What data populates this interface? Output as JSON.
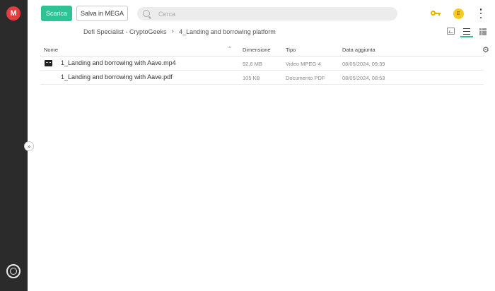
{
  "sidebar": {
    "logo_letter": "M",
    "expand_glyph": "»"
  },
  "toolbar": {
    "download_label": "Scarica",
    "save_label": "Salva in MEGA",
    "search_placeholder": "Cerca",
    "avatar_initial": "E",
    "accent_color": "#2fc294",
    "key_color": "#e3b400",
    "avatar_color": "#f6cb1b"
  },
  "breadcrumb": {
    "items": [
      "Defi Specialist - CryptoGeeks",
      "4_Landing and borrowing platform"
    ],
    "separator": "›"
  },
  "table": {
    "headers": {
      "name": "Nome",
      "size": "Dimensione",
      "type": "Tipo",
      "date": "Data aggiunta"
    },
    "sort_glyph": "⌃",
    "rows": [
      {
        "icon": "video-file-icon",
        "name": "1_Landing and borrowing with Aave.mp4",
        "size": "92,6 MB",
        "type": "Video MPEG-4",
        "date": "08/05/2024, 09:39"
      },
      {
        "icon": "",
        "name": "1_Landing and borrowing with Aave.pdf",
        "size": "105 KB",
        "type": "Documento PDF",
        "date": "08/05/2024, 08:53"
      }
    ]
  },
  "settings_glyph": "⚙"
}
